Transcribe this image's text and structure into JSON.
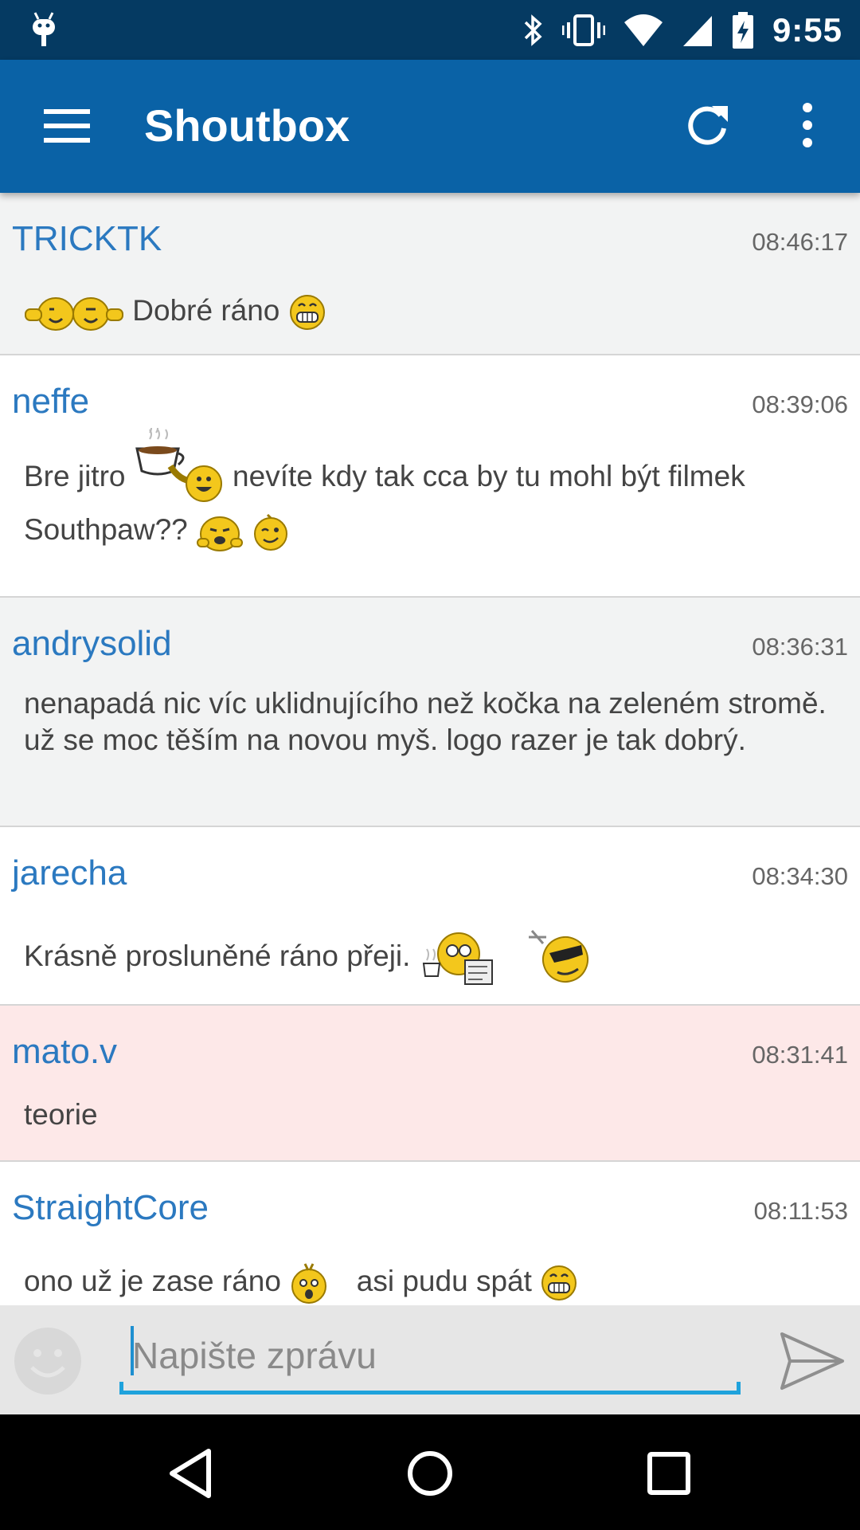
{
  "status_bar": {
    "time": "9:55",
    "icons": [
      "android-icon",
      "bluetooth-icon",
      "vibrate-icon",
      "wifi-icon",
      "signal-icon",
      "battery-charging-icon"
    ]
  },
  "app_bar": {
    "title": "Shoutbox",
    "icons": [
      "menu-icon",
      "refresh-icon",
      "more-vert-icon"
    ],
    "color": "#0a62a6"
  },
  "messages": [
    {
      "user": "TRICKTK",
      "time": "08:46:17",
      "lines": [
        "Dobré ráno"
      ]
    },
    {
      "user": "neffe",
      "time": "08:39:06",
      "lines": [
        "Bre jitro",
        "nevíte kdy tak cca by tu mohl být filmek",
        "Southpaw??"
      ]
    },
    {
      "user": "andrysolid",
      "time": "08:36:31",
      "lines": [
        "nenapadá nic víc uklidnujícího než kočka na zeleném stromě. už se moc těším na novou myš. logo razer je tak dobrý."
      ]
    },
    {
      "user": "jarecha",
      "time": "08:34:30",
      "lines": [
        "Krásně prosluněné ráno přeji."
      ]
    },
    {
      "user": "mato.v",
      "time": "08:31:41",
      "lines": [
        "teorie"
      ]
    },
    {
      "user": "StraightCore",
      "time": "08:11:53",
      "lines": [
        "ono už je zase ráno",
        "asi pudu spát"
      ]
    }
  ],
  "composer": {
    "placeholder": "Napište zprávu",
    "accent": "#1fa2dc"
  },
  "nav_bar": {
    "icons": [
      "back-icon",
      "home-icon",
      "recents-icon"
    ]
  }
}
